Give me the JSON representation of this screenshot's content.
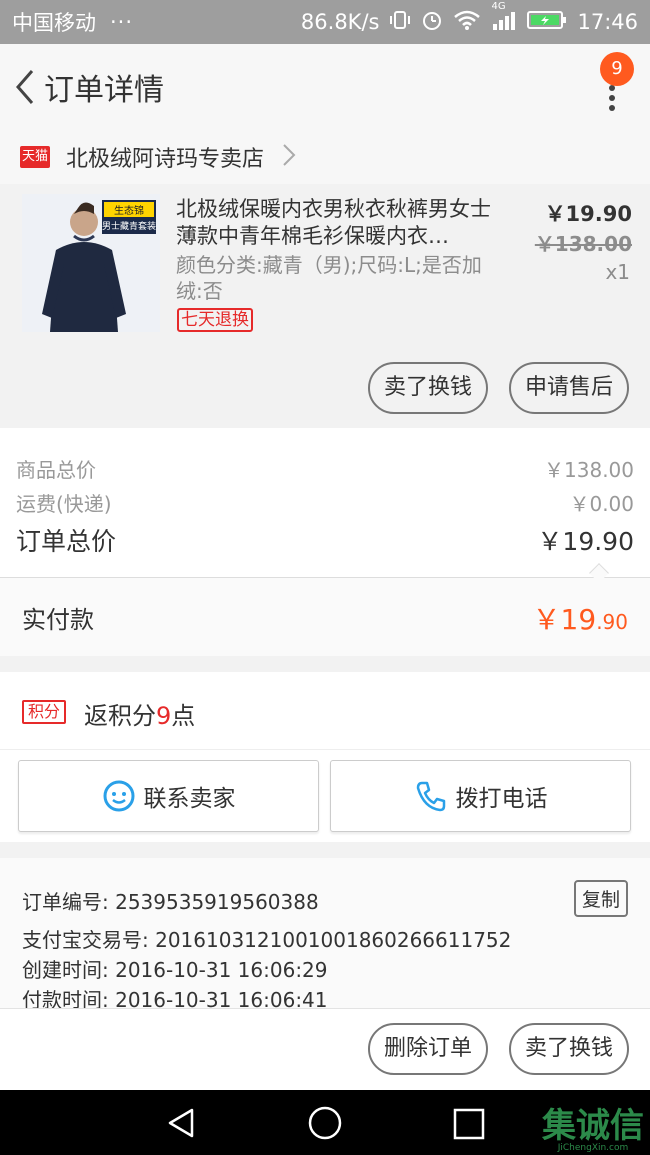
{
  "status_bar": {
    "carrier": "中国移动",
    "dots": "···",
    "speed": "86.8K/s",
    "network": "4G",
    "time": "17:46"
  },
  "header": {
    "title": "订单详情",
    "badge_count": "9"
  },
  "shop": {
    "tmall_label": "天猫",
    "name": "北极绒阿诗玛专卖店"
  },
  "product": {
    "title": "北极绒保暖内衣男秋衣秋裤男女士薄款中青年棉毛衫保暖内衣…",
    "attributes": "颜色分类:藏青（男);尺码:L;是否加绒:否",
    "return_tag": "七天退换",
    "price": "￥19.90",
    "original_price": "￥138.00",
    "quantity": "x1",
    "thumb_tag_top": "生态锦",
    "thumb_tag_bottom": "男士藏青套装",
    "sell_button": "卖了换钱",
    "after_sale_button": "申请售后"
  },
  "totals": {
    "goods_total_label": "商品总价",
    "goods_total_value": "￥138.00",
    "shipping_label": "运费(快递)",
    "shipping_value": "￥0.00",
    "order_total_label": "订单总价",
    "order_total_value": "￥19.90",
    "paid_label": "实付款",
    "paid_main": "￥19",
    "paid_decimal": ".90"
  },
  "points": {
    "tag": "积分",
    "text_prefix": "返积分",
    "amount": "9",
    "text_suffix": "点"
  },
  "contact": {
    "seller_label": "联系卖家",
    "phone_label": "拨打电话"
  },
  "order_info": {
    "order_no": "订单编号: 2539535919560388",
    "alipay_no": "支付宝交易号: 2016103121001001860266611752",
    "created": "创建时间: 2016-10-31 16:06:29",
    "paid": "付款时间: 2016-10-31 16:06:41",
    "copy_label": "复制"
  },
  "actions": {
    "delete_label": "删除订单",
    "sell_label": "卖了换钱"
  },
  "watermark": {
    "text": "集诚信",
    "sub": "JiChengXin.com"
  },
  "colors": {
    "accent": "#ff5a1f",
    "tmall_red": "#e62a2a",
    "status_bar": "#9e9e9e",
    "watermark_green": "#2c8a4a"
  }
}
